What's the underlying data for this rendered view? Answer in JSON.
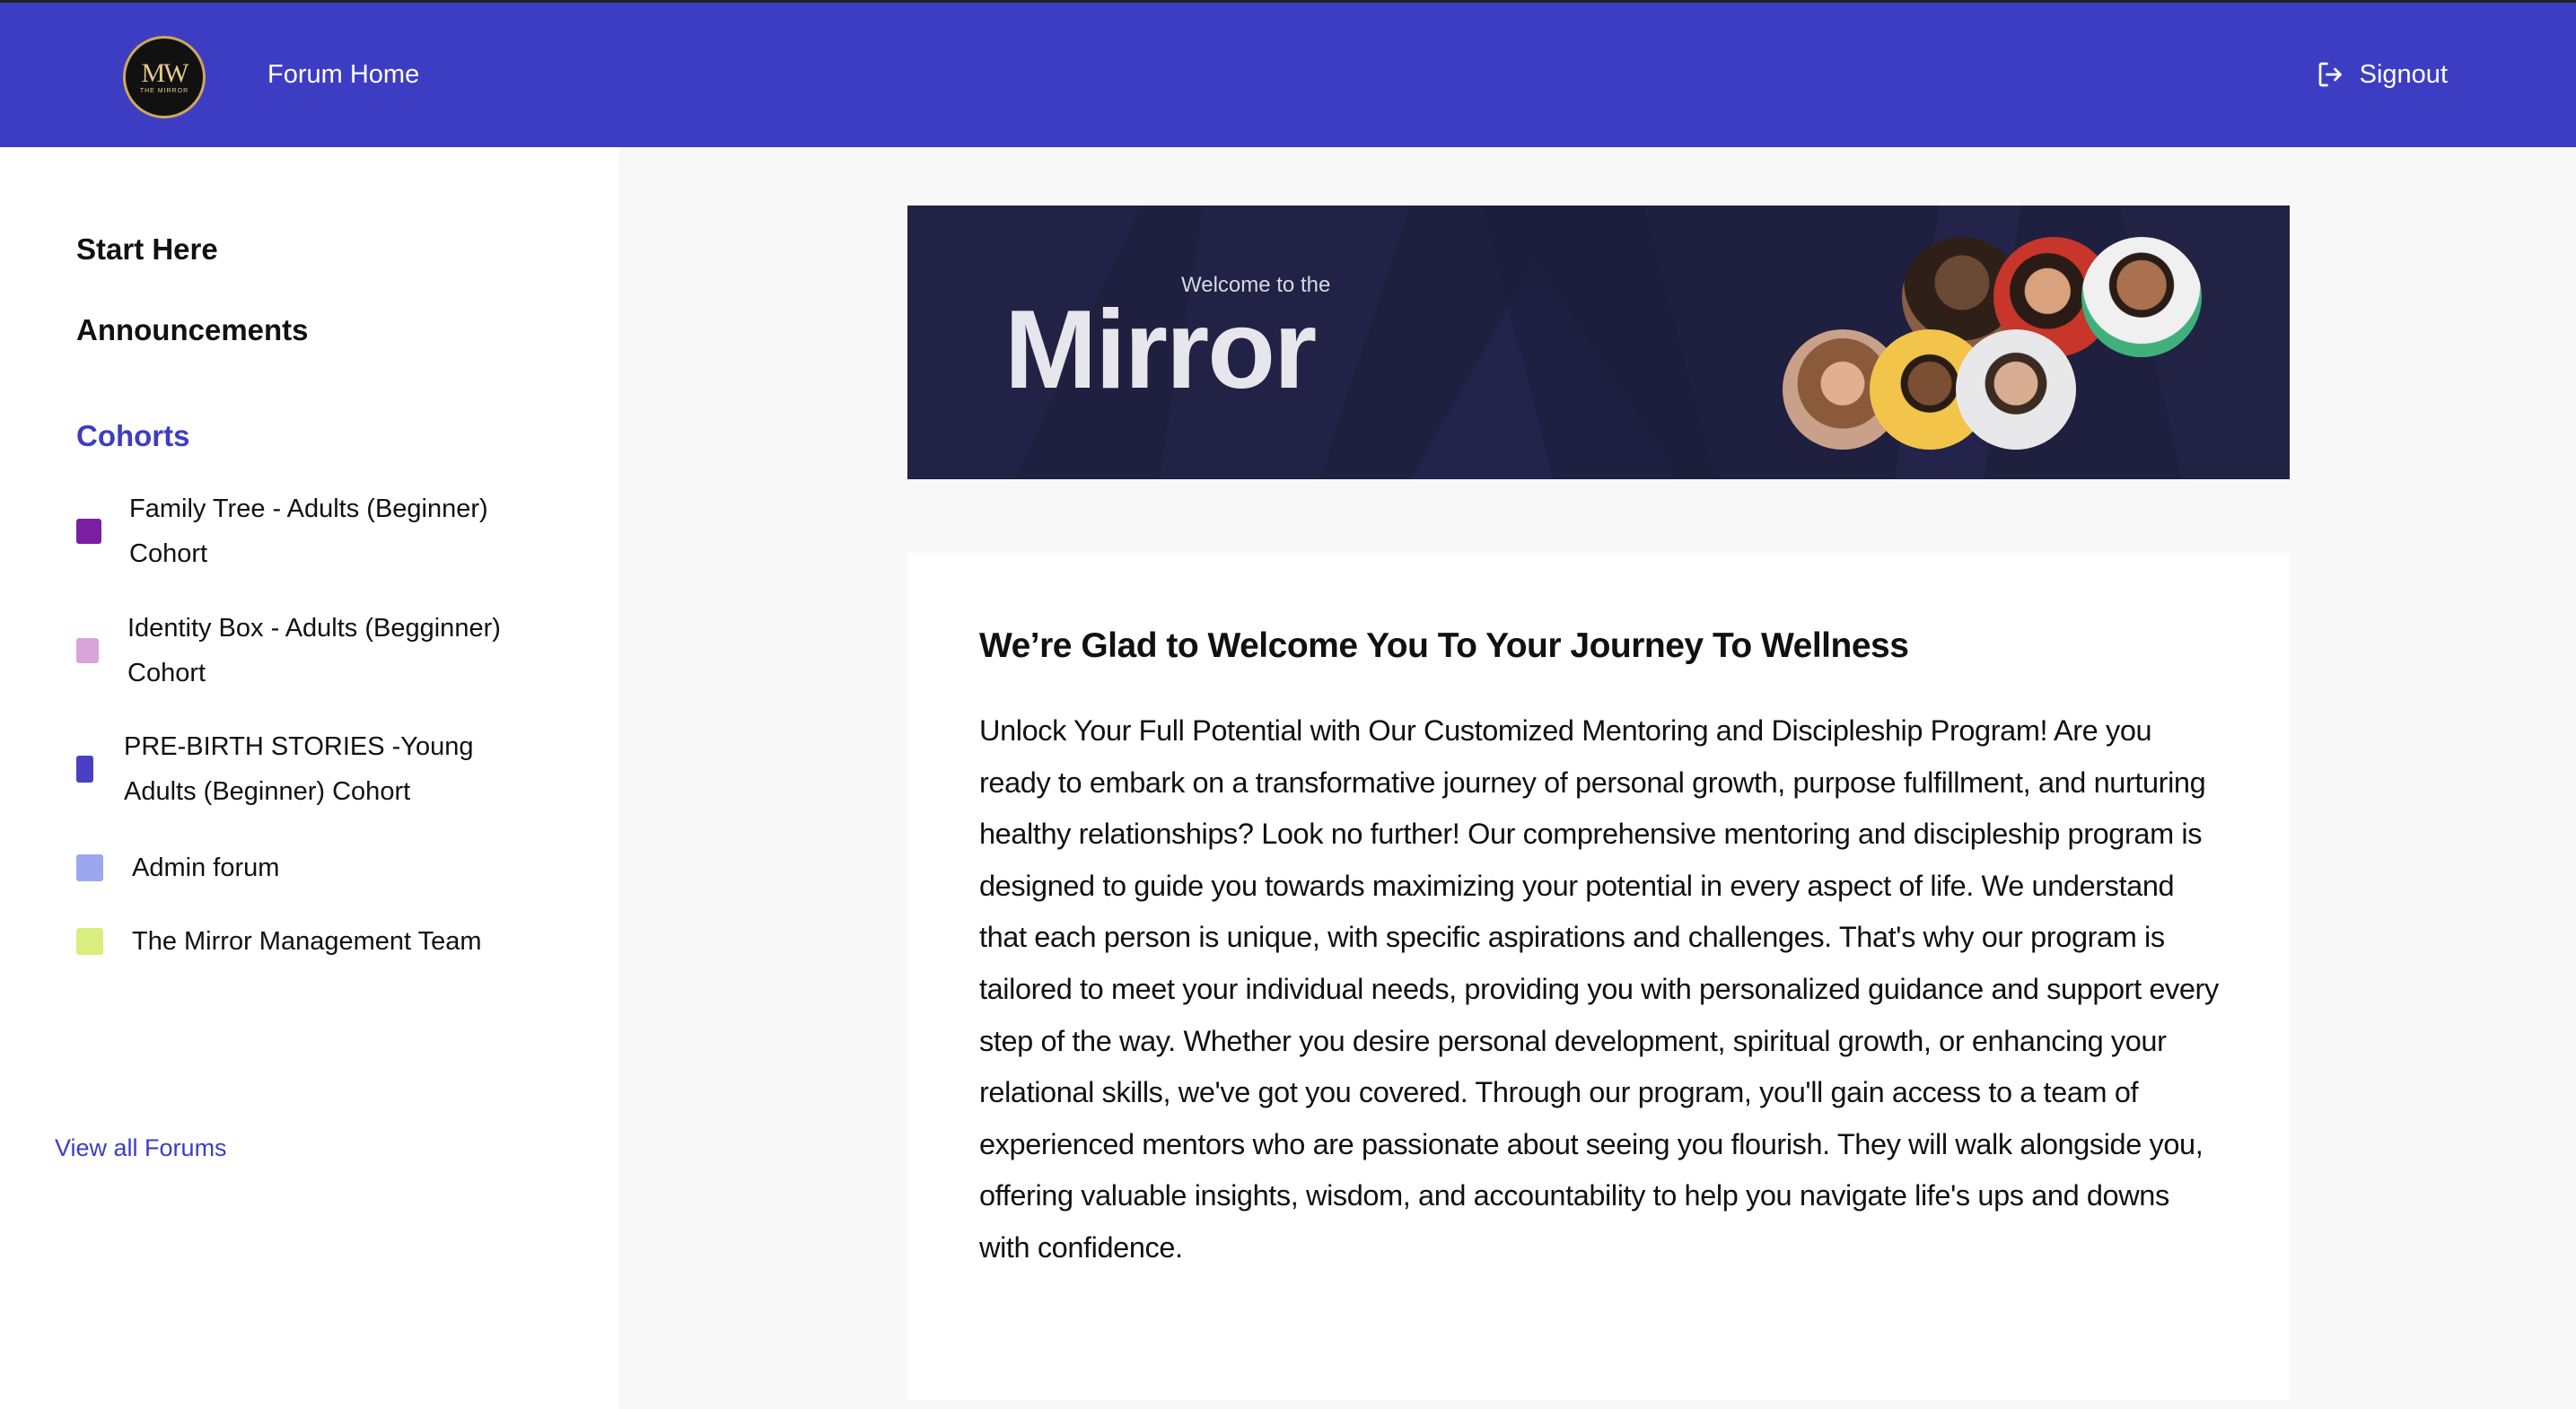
{
  "header": {
    "logo_text": "MW",
    "logo_subtitle": "THE MIRROR",
    "home_label": "Forum Home",
    "signout_label": "Signout",
    "background_color": "#3d3dc4"
  },
  "sidebar": {
    "links": [
      {
        "label": "Start Here"
      },
      {
        "label": "Announcements"
      }
    ],
    "section_title": "Cohorts",
    "cohorts": [
      {
        "label_line1": "Family Tree - Adults (Beginner)",
        "label_line2": "Cohort",
        "color": "#7b1fa2"
      },
      {
        "label_line1": "Identity Box - Adults (Begginner)",
        "label_line2": "Cohort",
        "color": "#d8a4dc"
      },
      {
        "label_line1": "PRE-BIRTH STORIES -Young",
        "label_line2": "Adults (Beginner) Cohort",
        "color": "#4b3fc4"
      },
      {
        "label_line1": "Admin forum",
        "label_line2": "",
        "color": "#9ba8ee"
      },
      {
        "label_line1": "The Mirror Management Team",
        "label_line2": "",
        "color": "#d9ee7e"
      }
    ],
    "view_all_label": "View all Forums"
  },
  "banner": {
    "welcome_text": "Welcome to the",
    "brand_text": "Mirror",
    "background_color": "#1f1f3f",
    "avatars": [
      "woman-smiling-avatar",
      "woman-red-avatar",
      "man-green-shirt-avatar",
      "woman-brown-hair-avatar",
      "man-yellow-bg-avatar",
      "man-beard-avatar"
    ]
  },
  "main": {
    "title": "We’re Glad to Welcome You To Your Journey To Wellness",
    "body": "Unlock Your Full Potential with Our Customized Mentoring and Discipleship Program! Are you ready to embark on a transformative journey of personal growth, purpose fulfillment, and nurturing healthy relationships? Look no further! Our comprehensive mentoring and discipleship program is designed to guide you towards maximizing your potential in every aspect of life. We understand that each person is unique, with specific aspirations and challenges. That's why our program is tailored to meet your individual needs, providing you with personalized guidance and support every step of the way. Whether you desire personal development, spiritual growth, or enhancing your relational skills, we've got you covered. Through our program, you'll gain access to a team of experienced mentors who are passionate about seeing you flourish. They will walk alongside you, offering valuable insights, wisdom, and accountability to help you navigate life's ups and downs with confidence."
  }
}
